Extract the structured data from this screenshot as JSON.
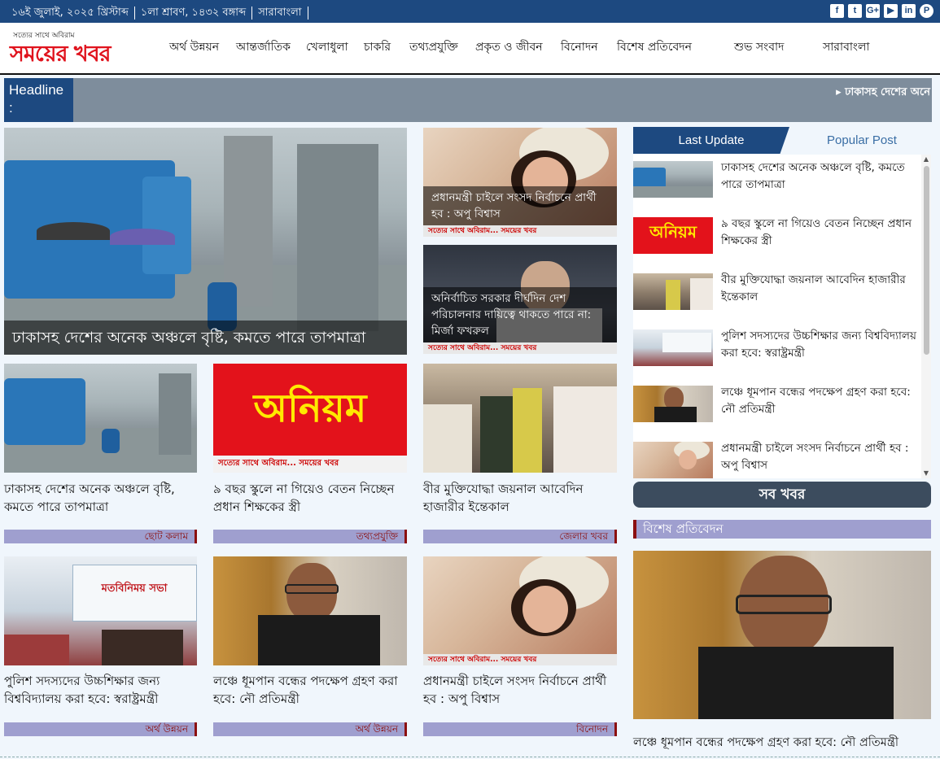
{
  "topbar": {
    "date": "১৬ই জুলাই, ২০২৫ খ্রিস্টাব্দ",
    "bangla_date": "১লা শ্রাবণ, ১৪৩২ বঙ্গাব্দ",
    "region": "সারাবাংলা",
    "social": [
      "facebook-icon",
      "twitter-icon",
      "google-plus-icon",
      "youtube-icon",
      "linkedin-icon",
      "pinterest-icon"
    ]
  },
  "logo": {
    "tagline": "সত্যের সাথে অবিরাম",
    "name": "সময়ের খবর"
  },
  "nav": [
    "অর্থ উন্নয়ন",
    "আন্তর্জাতিক",
    "খেলাধুলা",
    "চাকরি",
    "তথ্যপ্রযুক্তি",
    "প্রকৃত ও জীবন",
    "বিনোদন",
    "বিশেষ প্রতিবেদন",
    "শুভ সংবাদ",
    "সারাবাংলা"
  ],
  "headline": {
    "label": "Headline :",
    "ticker": "ঢাকাসহ দেশের অনে"
  },
  "featured": {
    "main": "ঢাকাসহ দেশের অনেক অঞ্চলে বৃষ্টি, কমতে পারে তাপমাত্রা",
    "side1": "প্রধানমন্ত্রী চাইলে সংসদ নির্বাচনে প্রার্থী হব : অপু বিশ্বাস",
    "side2": "অনির্বাচিত সরকার দীর্ঘদিন দেশ পরিচালনার দায়িত্বে থাকতে পারে না: মির্জা ফখরুল",
    "strip": "সত্যের সাথে অবিরাম... সময়ের খবর"
  },
  "cards": [
    {
      "title": "ঢাকাসহ দেশের অনেক অঞ্চলে বৃষ্টি, কমতে পারে তাপমাত্রা",
      "category": "ছোট কলাম"
    },
    {
      "title": "৯ বছর স্কুলে না গিয়েও বেতন নিচ্ছেন প্রধান শিক্ষকের স্ত্রী",
      "category": "তথ্যপ্রযুক্তি",
      "image_text": "অনিয়ম",
      "strip": "সত্যের সাথে অবিরাম... সময়ের খবর"
    },
    {
      "title": "বীর মুক্তিযোদ্ধা জয়নাল আবেদিন হাজারীর ইন্তেকাল",
      "category": "জেলার খবর"
    },
    {
      "title": "পুলিশ সদস্যদের উচ্চশিক্ষার জন্য বিশ্ববিদ্যালয় করা হবে: স্বরাষ্ট্রমন্ত্রী",
      "category": "অর্থ উন্নয়ন",
      "image_text": "মতবিনিময় সভা"
    },
    {
      "title": "লঞ্চে ধূমপান বন্ধের পদক্ষেপ গ্রহণ করা হবে: নৌ প্রতিমন্ত্রী",
      "category": "অর্থ উন্নয়ন"
    },
    {
      "title": "প্রধানমন্ত্রী চাইলে সংসদ নির্বাচনে প্রার্থী হব : অপু বিশ্বাস",
      "category": "বিনোদন",
      "strip": "সত্যের সাথে অবিরাম... সময়ের খবর"
    }
  ],
  "sidebar": {
    "tabs": [
      "Last Update",
      "Popular Post"
    ],
    "items": [
      "ঢাকাসহ দেশের অনেক অঞ্চলে বৃষ্টি, কমতে পারে তাপমাত্রা",
      "৯ বছর স্কুলে না গিয়েও বেতন নিচ্ছেন প্রধান শিক্ষকের স্ত্রী",
      "বীর মুক্তিযোদ্ধা জয়নাল আবেদিন হাজারীর ইন্তেকাল",
      "পুলিশ সদস্যদের উচ্চশিক্ষার জন্য বিশ্ববিদ্যালয় করা হবে: স্বরাষ্ট্রমন্ত্রী",
      "লঞ্চে ধূমপান বন্ধের পদক্ষেপ গ্রহণ করা হবে: নৌ প্রতিমন্ত্রী",
      "প্রধানমন্ত্রী চাইলে সংসদ নির্বাচনে প্রার্থী হব : অপু বিশ্বাস"
    ],
    "thumb_text": "অনিয়ম",
    "all_news": "সব খবর",
    "special_heading": "বিশেষ প্রতিবেদন",
    "special_title": "লঞ্চে ধূমপান বন্ধের পদক্ষেপ গ্রহণ করা হবে: নৌ প্রতিমন্ত্রী"
  },
  "colors": {
    "brand": "#1d4980",
    "accent": "#e3121b",
    "category_bg": "#9f9fcf",
    "category_text": "#8b0f0f"
  }
}
